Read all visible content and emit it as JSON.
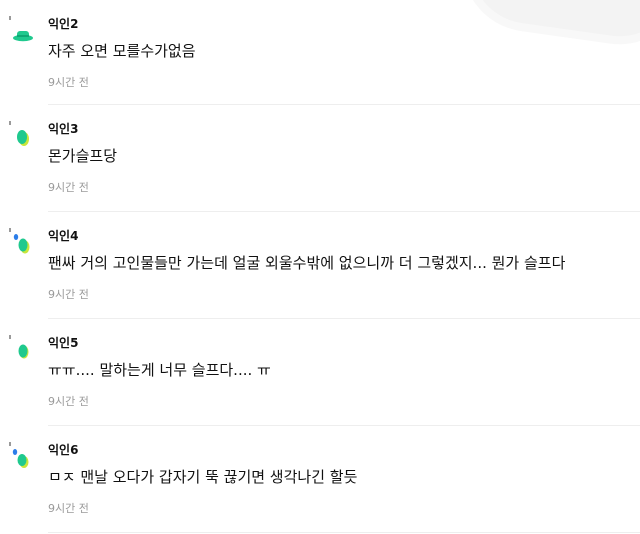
{
  "comments": [
    {
      "author": "익인2",
      "text": "자주 오면 모를수가없음",
      "time": "9시간 전",
      "avatar_icon": "green-hat-avatar-icon"
    },
    {
      "author": "익인3",
      "text": "몬가슬프당",
      "time": "9시간 전",
      "avatar_icon": "green-leaf-avatar-icon"
    },
    {
      "author": "익인4",
      "text": "팬싸 거의 고인물들만 가는데 얼굴 외울수밖에 없으니까 더 그렇겠지... 뭔가 슬프다",
      "time": "9시간 전",
      "avatar_icon": "green-leaf-avatar-icon"
    },
    {
      "author": "익인5",
      "text": "ㅠㅠ.... 말하는게 너무 슬프다.... ㅠ",
      "time": "9시간 전",
      "avatar_icon": "green-leaf-avatar-icon"
    },
    {
      "author": "익인6",
      "text": "ㅁㅈ 맨날 오다가 갑자기 뚝 끊기면 생각나긴 할듯",
      "time": "9시간 전",
      "avatar_icon": "green-leaf-avatar-icon"
    }
  ],
  "colors": {
    "avatar_primary": "#1fc98e",
    "avatar_secondary": "#c8e63a",
    "avatar_tertiary": "#2b7de9",
    "time_text": "#9a9a9a",
    "divider": "#eeeeee"
  }
}
